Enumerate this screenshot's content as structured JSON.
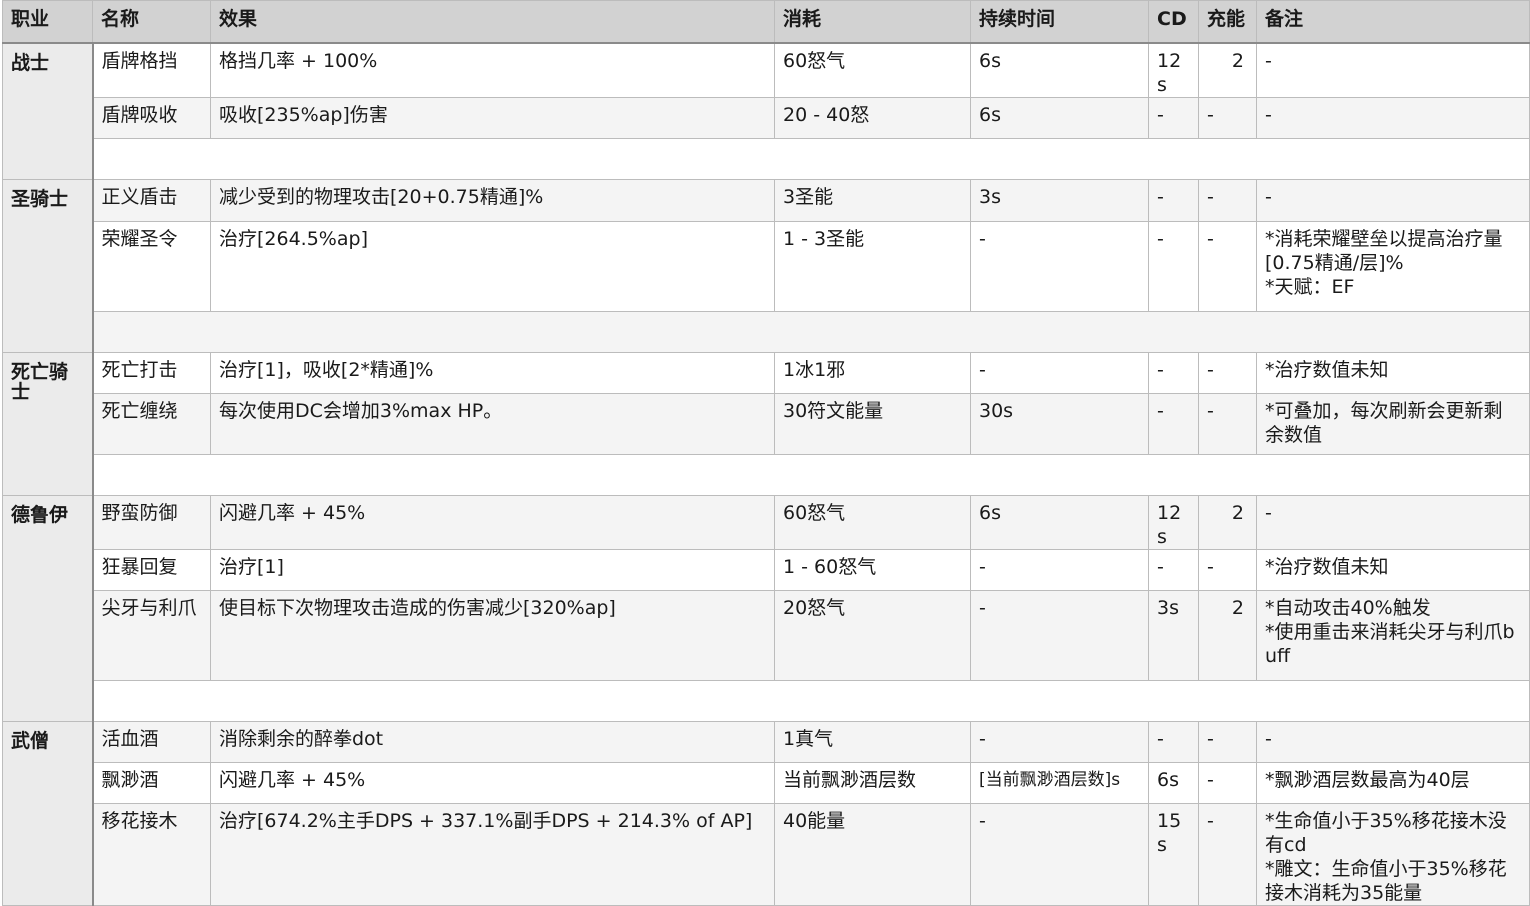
{
  "headers": {
    "class": "职业",
    "name": "名称",
    "effect": "效果",
    "cost": "消耗",
    "duration": "持续时间",
    "cd": "CD",
    "charges": "充能",
    "notes": "备注"
  },
  "classes": {
    "warrior": "战士",
    "paladin": "圣骑士",
    "dk": "死亡骑士",
    "druid": "德鲁伊",
    "monk": "武僧"
  },
  "rows": [
    {
      "name": "盾牌格挡",
      "effect": "格挡几率 + 100%",
      "cost": "60怒气",
      "duration": "6s",
      "cd": "12s",
      "charges": "2",
      "notes": "-"
    },
    {
      "name": "盾牌吸收",
      "effect": "吸收[235%ap]伤害",
      "cost": "20 - 40怒",
      "duration": "6s",
      "cd": "-",
      "charges": "-",
      "notes": "-"
    },
    {
      "name": "正义盾击",
      "effect": "减少受到的物理攻击[20+0.75精通]%",
      "cost": "3圣能",
      "duration": "3s",
      "cd": "-",
      "charges": "-",
      "notes": "-"
    },
    {
      "name": "荣耀圣令",
      "effect": "治疗[264.5%ap]",
      "cost": "1 - 3圣能",
      "duration": "-",
      "cd": "-",
      "charges": "-",
      "notes1": "*消耗荣耀壁垒以提高治疗量",
      "notes2": "[0.75精通/层]%",
      "notes3": "*天赋：EF"
    },
    {
      "name": "死亡打击",
      "effect": "治疗[1]，吸收[2*精通]%",
      "cost": "1冰1邪",
      "duration": "-",
      "cd": "-",
      "charges": "-",
      "notes": "*治疗数值未知"
    },
    {
      "name": "死亡缠绕",
      "effect": "每次使用DC会增加3%max HP。",
      "cost": "30符文能量",
      "duration": "30s",
      "cd": "-",
      "charges": "-",
      "notes": "*可叠加，每次刷新会更新剩余数值"
    },
    {
      "name": "野蛮防御",
      "effect": "闪避几率 + 45%",
      "cost": "60怒气",
      "duration": "6s",
      "cd": "12s",
      "charges": "2",
      "notes": "-"
    },
    {
      "name": "狂暴回复",
      "effect": "治疗[1]",
      "cost": "1 - 60怒气",
      "duration": "-",
      "cd": "-",
      "charges": "-",
      "notes": "*治疗数值未知"
    },
    {
      "name": "尖牙与利爪",
      "effect": "使目标下次物理攻击造成的伤害减少[320%ap]",
      "cost": "20怒气",
      "duration": "-",
      "cd": "3s",
      "charges": "2",
      "notes1": "*自动攻击40%触发",
      "notes2": "*使用重击来消耗尖牙与利爪buff"
    },
    {
      "name": "活血酒",
      "effect": "消除剩余的醉拳dot",
      "cost": "1真气",
      "duration": "-",
      "cd": "-",
      "charges": "-",
      "notes": "-"
    },
    {
      "name": "飘渺酒",
      "effect": "闪避几率 + 45%",
      "cost": "当前飘渺酒层数",
      "duration": "[当前飘渺酒层数]s",
      "cd": "6s",
      "charges": "-",
      "notes": "*飘渺酒层数最高为40层"
    },
    {
      "name": "移花接木",
      "effect": "治疗[674.2%主手DPS + 337.1%副手DPS + 214.3% of AP]",
      "cost": "40能量",
      "duration": "-",
      "cd": "15s",
      "charges": "-",
      "notes1": "*生命值小于35%移花接木没有cd",
      "notes2": "*雕文：生命值小于35%移花接木消耗为35能量"
    }
  ]
}
